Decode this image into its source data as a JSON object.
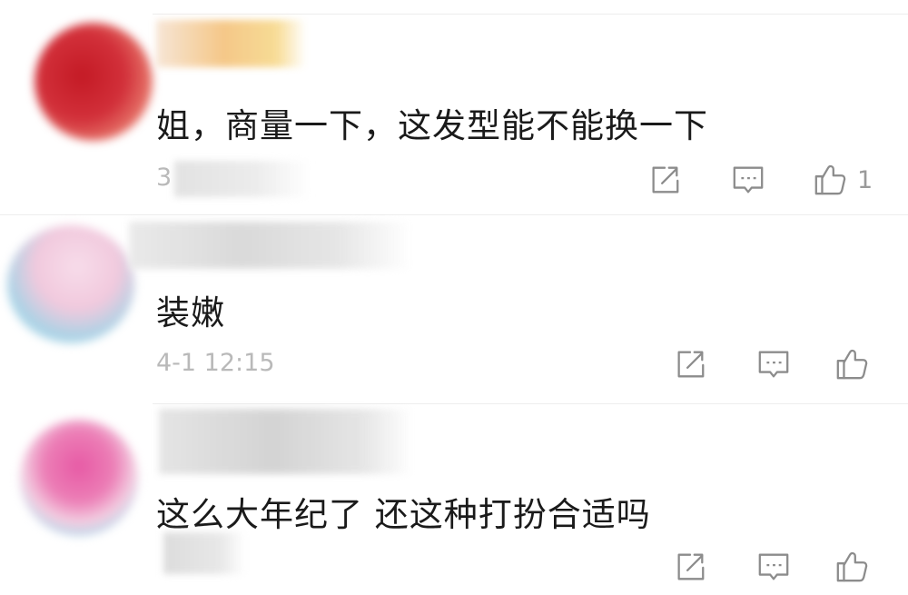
{
  "comments": [
    {
      "text": "姐，商量一下，这发型能不能换一下",
      "time": "3",
      "like_count": "1",
      "avatar_colors": [
        "#c41a25",
        "#e05a4a"
      ],
      "username_colors": [
        "#f4c27c",
        "#f7d88a"
      ]
    },
    {
      "text": "装嫩",
      "time": "4-1 12:15",
      "like_count": "",
      "avatar_colors": [
        "#f1c9dd",
        "#a7d3e6"
      ],
      "username_colors": [
        "#d6d6d6",
        "#e4e4e4"
      ]
    },
    {
      "text": "这么大年纪了 还这种打扮合适吗",
      "time": "",
      "like_count": "",
      "avatar_colors": [
        "#e75aa5",
        "#a8d5ea"
      ],
      "username_colors": [
        "#cfcfcf",
        "#e3e3e3"
      ]
    }
  ],
  "icons": {
    "share": "share-icon",
    "reply": "comment-icon",
    "like": "thumbs-up-icon"
  },
  "colors": {
    "icon_gray": "#8c8c8c",
    "text": "#1a1a1a",
    "time": "#b9b9b9",
    "divider": "#ededed"
  }
}
